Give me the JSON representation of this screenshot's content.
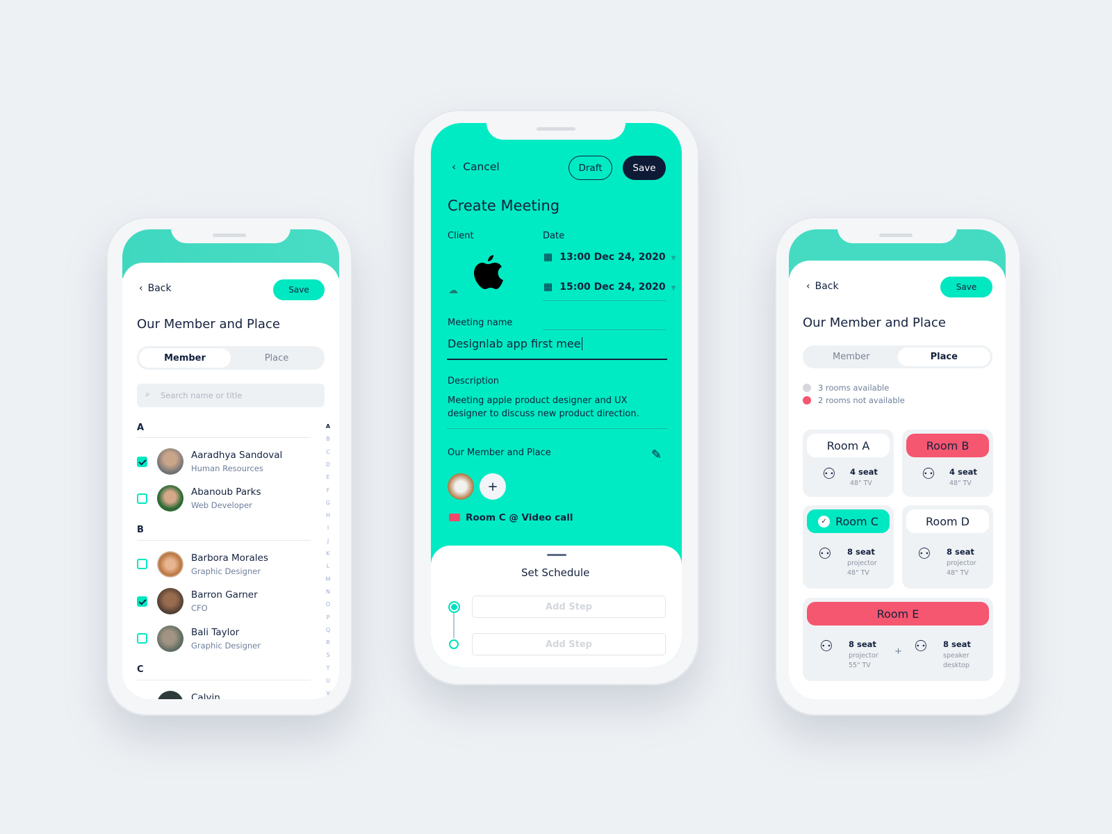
{
  "colors": {
    "accent": "#00e8c1",
    "danger": "#f55670",
    "dark": "#0f1b36",
    "background": "#eef1f4"
  },
  "left": {
    "back": "Back",
    "save": "Save",
    "title": "Our Member and Place",
    "tabs": [
      {
        "label": "Member",
        "active": true
      },
      {
        "label": "Place",
        "active": false
      }
    ],
    "search_placeholder": "Search name or title",
    "sections": [
      {
        "letter": "A",
        "members": [
          {
            "name": "Aaradhya Sandoval",
            "role": "Human Resources",
            "checked": true
          },
          {
            "name": "Abanoub Parks",
            "role": "Web Developer",
            "checked": false
          }
        ]
      },
      {
        "letter": "B",
        "members": [
          {
            "name": "Barbora Morales",
            "role": "Graphic Designer",
            "checked": false
          },
          {
            "name": "Barron Garner",
            "role": "CFO",
            "checked": true
          },
          {
            "name": "Bali Taylor",
            "role": "Graphic Designer",
            "checked": false
          }
        ]
      },
      {
        "letter": "C",
        "members": [
          {
            "name": "Calvin",
            "role": "",
            "checked": false
          }
        ]
      }
    ],
    "index": [
      "A",
      "B",
      "C",
      "D",
      "E",
      "F",
      "G",
      "H",
      "I",
      "J",
      "K",
      "L",
      "M",
      "N",
      "O",
      "P",
      "Q",
      "R",
      "S",
      "T",
      "U",
      "V"
    ]
  },
  "center": {
    "cancel": "Cancel",
    "draft": "Draft",
    "save": "Save",
    "title": "Create Meeting",
    "client_label": "Client",
    "client_icon": "apple-logo",
    "date_label": "Date",
    "dates": [
      "13:00 Dec 24, 2020",
      "15:00 Dec 24, 2020"
    ],
    "meeting_name_label": "Meeting name",
    "meeting_name_value": "Designlab app first mee",
    "description_label": "Description",
    "description": "Meeting apple product designer and UX designer to discuss new product direction.",
    "member_place_label": "Our Member and Place",
    "add": "+",
    "room": "Room C @ Video call",
    "schedule_title": "Set Schedule",
    "steps": [
      "Add Step",
      "Add Step"
    ]
  },
  "right": {
    "back": "Back",
    "save": "Save",
    "title": "Our Member and Place",
    "tabs": [
      {
        "label": "Member",
        "active": false
      },
      {
        "label": "Place",
        "active": true
      }
    ],
    "legend": [
      "3 rooms available",
      "2 rooms not available"
    ],
    "rooms": [
      {
        "name": "Room A",
        "status": "available",
        "seat": "4 seat",
        "specs": [
          "48\" TV"
        ]
      },
      {
        "name": "Room B",
        "status": "not-available",
        "seat": "4 seat",
        "specs": [
          "48\" TV"
        ]
      },
      {
        "name": "Room C",
        "status": "selected",
        "seat": "8 seat",
        "specs": [
          "projector",
          "48\" TV"
        ]
      },
      {
        "name": "Room D",
        "status": "available",
        "seat": "8 seat",
        "specs": [
          "projector",
          "48\" TV"
        ]
      },
      {
        "name": "Room E",
        "status": "not-available",
        "seat": "8 seat",
        "specs": [
          "projector",
          "55\" TV"
        ],
        "seat2": "8 seat",
        "specs2": [
          "speaker",
          "desktop"
        ],
        "plus": "+"
      }
    ]
  }
}
